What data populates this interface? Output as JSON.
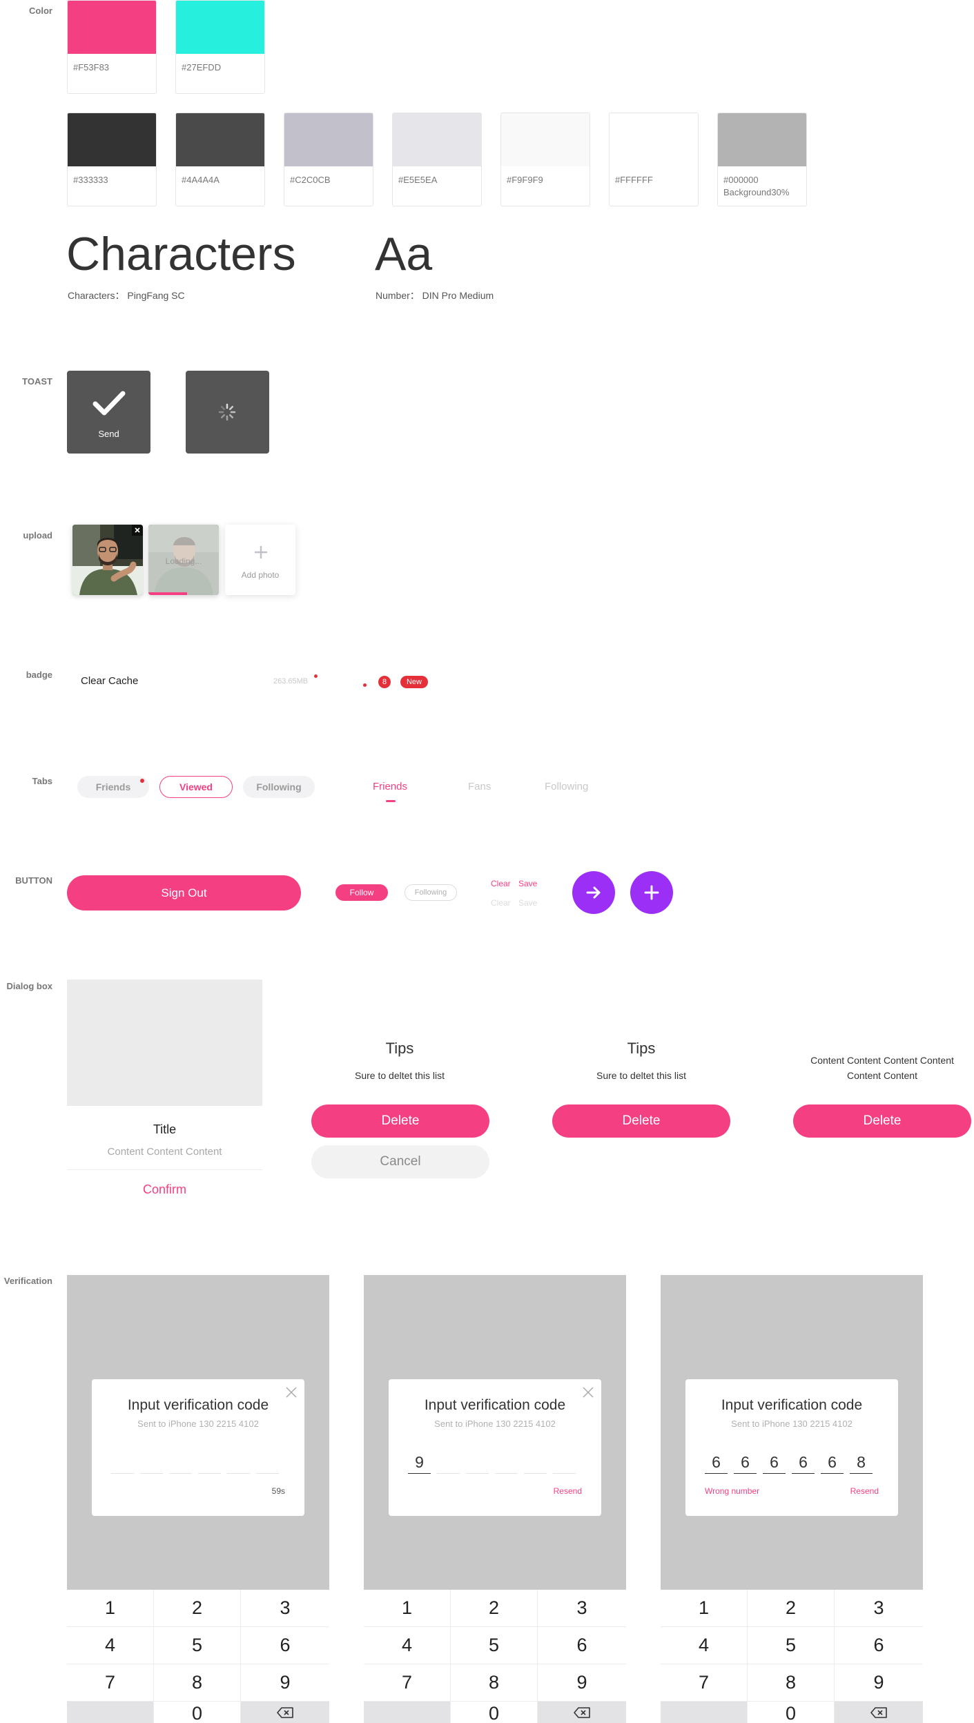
{
  "sections": {
    "color": "Color",
    "toast": "TOAST",
    "upload": "upload",
    "badge": "badge",
    "tabs": "Tabs",
    "button": "BUTTON",
    "dialog": "Dialog box",
    "verification": "Verification"
  },
  "colors": {
    "primary": [
      {
        "code": "#F53F83",
        "hex": "#F53F83"
      },
      {
        "code": "#27EFDD",
        "hex": "#27EFDD"
      }
    ],
    "neutrals": [
      {
        "code": "#333333",
        "hex": "#333333"
      },
      {
        "code": "#4A4A4A",
        "hex": "#4A4A4A"
      },
      {
        "code": "#C2C0CB",
        "hex": "#C2C0CB"
      },
      {
        "code": "#E5E5EA",
        "hex": "#E5E5EA"
      },
      {
        "code": "#F9F9F9",
        "hex": "#F9F9F9"
      },
      {
        "code": "#FFFFFF",
        "hex": "#FFFFFF"
      },
      {
        "code": "#000000",
        "code2": "Background30%",
        "hex": "#B3B3B3"
      }
    ]
  },
  "typography": {
    "characters_sample": "Characters",
    "characters_note": "Characters： PingFang SC",
    "number_sample": "Aa",
    "number_note": "Number： DIN Pro  Medium"
  },
  "toast": {
    "send_label": "Send",
    "check_icon": "check-icon",
    "spinner_icon": "spinner-icon"
  },
  "upload": {
    "loading_label": "Loading...",
    "add_label": "Add photo",
    "progress": 0.55
  },
  "badge": {
    "clear_cache_label": "Clear Cache",
    "cache_size": "263.65MB",
    "count": "8",
    "new_label": "New"
  },
  "tabs": {
    "pills": [
      "Friends",
      "Viewed",
      "Following"
    ],
    "active_pill": "Viewed",
    "lines": [
      "Friends",
      "Fans",
      "Following"
    ],
    "active_line": "Friends"
  },
  "buttons": {
    "sign_out": "Sign Out",
    "follow": "Follow",
    "following": "Following",
    "clear": "Clear",
    "save": "Save",
    "clear_disabled": "Clear",
    "save_disabled": "Save",
    "arrow_icon": "arrow-right-icon",
    "plus_icon": "plus-icon"
  },
  "dialogs": {
    "card": {
      "title": "Title",
      "content": "Content Content Content",
      "confirm": "Confirm"
    },
    "tips1": {
      "title": "Tips",
      "text": "Sure to deltet this list",
      "delete": "Delete",
      "cancel": "Cancel"
    },
    "tips2": {
      "title": "Tips",
      "text": "Sure to deltet this list",
      "delete": "Delete"
    },
    "content": {
      "line1": "Content Content Content Content",
      "line2": "Content Content",
      "delete": "Delete"
    }
  },
  "verification": {
    "title": "Input verification code",
    "sent": "Sent to iPhone  130 2215 4102",
    "screens": [
      {
        "digits": [
          "",
          "",
          "",
          "",
          "",
          ""
        ],
        "left_hint": "",
        "right_hint": "59s"
      },
      {
        "digits": [
          "9",
          "",
          "",
          "",
          "",
          ""
        ],
        "left_hint": "",
        "right_hint": "Resend"
      },
      {
        "digits": [
          "6",
          "6",
          "6",
          "6",
          "6",
          "8"
        ],
        "left_hint": "Wrong number",
        "right_hint": "Resend"
      }
    ],
    "keys": [
      "1",
      "2",
      "3",
      "4",
      "5",
      "6",
      "7",
      "8",
      "9",
      "",
      "0",
      "backspace"
    ]
  },
  "accent": "#F53F83",
  "purple": "#9B2FF5"
}
